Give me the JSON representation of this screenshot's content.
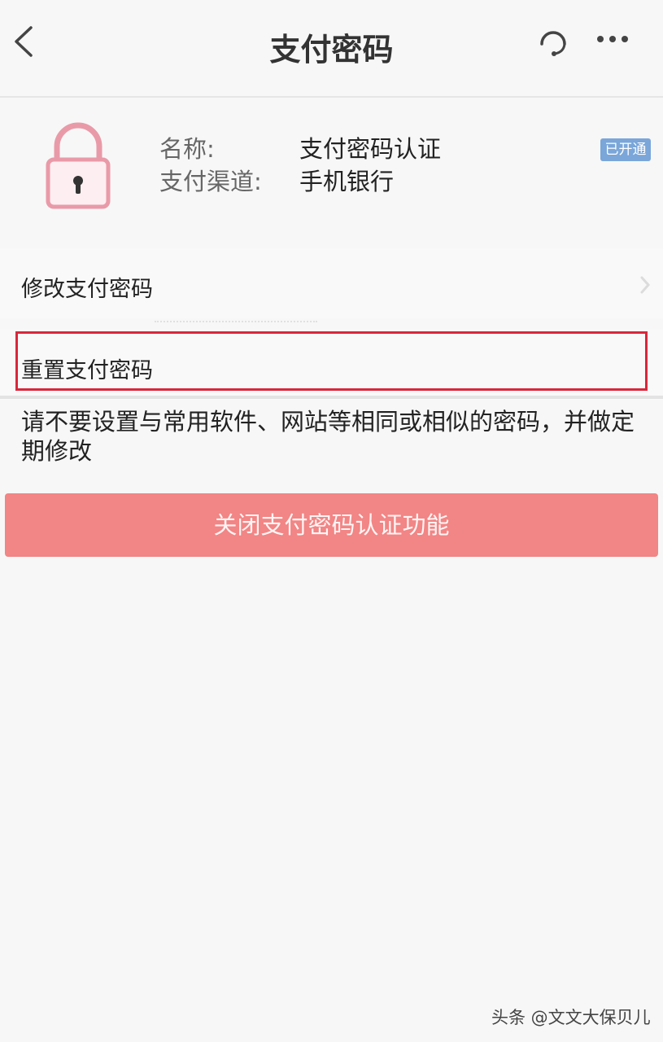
{
  "header": {
    "title": "支付密码",
    "back_icon": "chevron-left-icon",
    "support_icon": "headset-icon",
    "more_icon": "more-dots-icon"
  },
  "info": {
    "lock_icon": "lock-icon",
    "name_label": "名称:",
    "name_value": "支付密码认证",
    "channel_label": "支付渠道:",
    "channel_value": "手机银行",
    "status": "已开通"
  },
  "menu": {
    "items": [
      {
        "label": "修改支付密码"
      },
      {
        "label": "重置支付密码"
      }
    ]
  },
  "notice": "请不要设置与常用软件、网站等相同或相似的密码，并做定期修改",
  "actions": {
    "close_label": "关闭支付密码认证功能"
  },
  "watermark": "头条 @文文大保贝儿",
  "colors": {
    "accent_button": "#f28585",
    "highlight_border": "#d8283b",
    "badge": "#7aa6d9",
    "lock_stroke": "#e99aa8"
  }
}
